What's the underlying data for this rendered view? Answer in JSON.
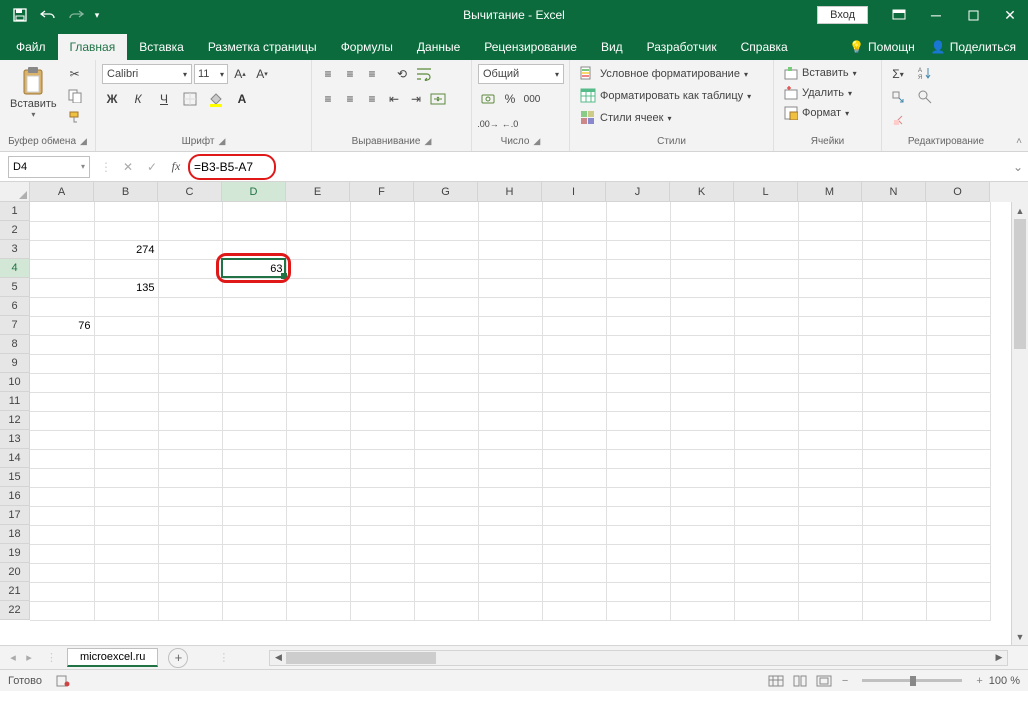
{
  "titlebar": {
    "title": "Вычитание - Excel",
    "login": "Вход"
  },
  "tabs": {
    "items": [
      "Файл",
      "Главная",
      "Вставка",
      "Разметка страницы",
      "Формулы",
      "Данные",
      "Рецензирование",
      "Вид",
      "Разработчик",
      "Справка"
    ],
    "tell_me": "Помощн",
    "share": "Поделиться"
  },
  "ribbon": {
    "clipboard": {
      "paste": "Вставить",
      "label": "Буфер обмена"
    },
    "font": {
      "name": "Calibri",
      "size": "11",
      "label": "Шрифт",
      "bold": "Ж",
      "italic": "К",
      "underline": "Ч"
    },
    "alignment": {
      "label": "Выравнивание"
    },
    "number": {
      "format": "Общий",
      "label": "Число"
    },
    "styles": {
      "conditional": "Условное форматирование",
      "format_table": "Форматировать как таблицу",
      "cell_styles": "Стили ячеек",
      "label": "Стили"
    },
    "cells": {
      "insert": "Вставить",
      "delete": "Удалить",
      "format": "Формат",
      "label": "Ячейки"
    },
    "editing": {
      "label": "Редактирование"
    }
  },
  "formula_bar": {
    "cell_ref": "D4",
    "formula": "=B3-B5-A7"
  },
  "grid": {
    "columns": [
      "A",
      "B",
      "C",
      "D",
      "E",
      "F",
      "G",
      "H",
      "I",
      "J",
      "K",
      "L",
      "M",
      "N",
      "O"
    ],
    "rows": 22,
    "active": {
      "col": "D",
      "row": 4
    },
    "data": {
      "B3": "274",
      "D4": "63",
      "B5": "135",
      "A7": "76"
    }
  },
  "sheet": {
    "name": "microexcel.ru"
  },
  "status": {
    "ready": "Готово",
    "zoom": "100 %"
  }
}
